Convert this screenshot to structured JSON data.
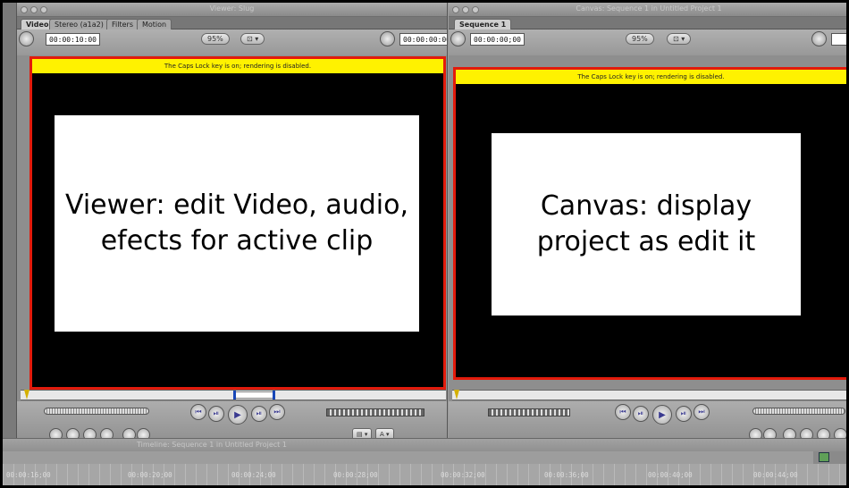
{
  "viewer": {
    "window_title": "Viewer: Slug",
    "tabs": [
      "Video",
      "Stereo (a1a2)",
      "Filters",
      "Motion"
    ],
    "active_tab": "Video",
    "duration_timecode": "00:00:10:00",
    "zoom": "95%",
    "view_menu": "⊡ ▾",
    "current_timecode": "00:00:00:00",
    "caps_lock_warning": "The Caps Lock key is on; rendering is disabled.",
    "annotation": "Viewer: edit Video, audio, efects for active clip"
  },
  "canvas": {
    "window_title": "Canvas: Sequence 1 in Untitled Project 1",
    "tabs": [
      "Sequence 1"
    ],
    "active_tab": "Sequence 1",
    "duration_timecode": "00:00:00;00",
    "zoom": "95%",
    "view_menu": "⊡ ▾",
    "caps_lock_warning": "The Caps Lock key is on; rendering is disabled.",
    "annotation": "Canvas: display project as edit it"
  },
  "transport": {
    "prev_edit": "⏮",
    "play_in_out": "⏯",
    "play": "▶",
    "play_around": "⏯",
    "next_edit": "⏭",
    "overlay_menu": "▤ ▾",
    "overwrite_menu": "A ▾"
  },
  "timeline": {
    "title": "Timeline: Sequence 1 in Untitled Project 1",
    "ruler_marks": [
      "00:00:16;00",
      "00:00:20;00",
      "00:00:24;00",
      "00:00:28;00",
      "00:00:32;00",
      "00:00:36;00",
      "00:00:40;00",
      "00:00:44;00"
    ]
  }
}
